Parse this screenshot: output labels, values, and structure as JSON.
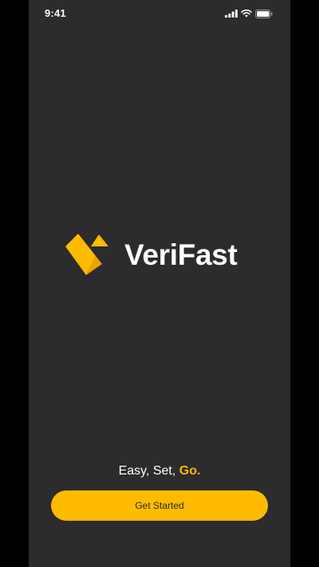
{
  "status_bar": {
    "time": "9:41",
    "icons": [
      "cellular-signal-icon",
      "wifi-icon",
      "battery-icon"
    ]
  },
  "brand": {
    "name": "VeriFast",
    "logo_icon": "verifast-logo-icon",
    "accent_color": "#ffbb00"
  },
  "tagline": {
    "part1": "Easy, Set, ",
    "accent": "Go."
  },
  "cta": {
    "label": "Get Started"
  },
  "colors": {
    "background": "#2c2b2d",
    "accent": "#ffbb00",
    "text": "#ffffff"
  }
}
